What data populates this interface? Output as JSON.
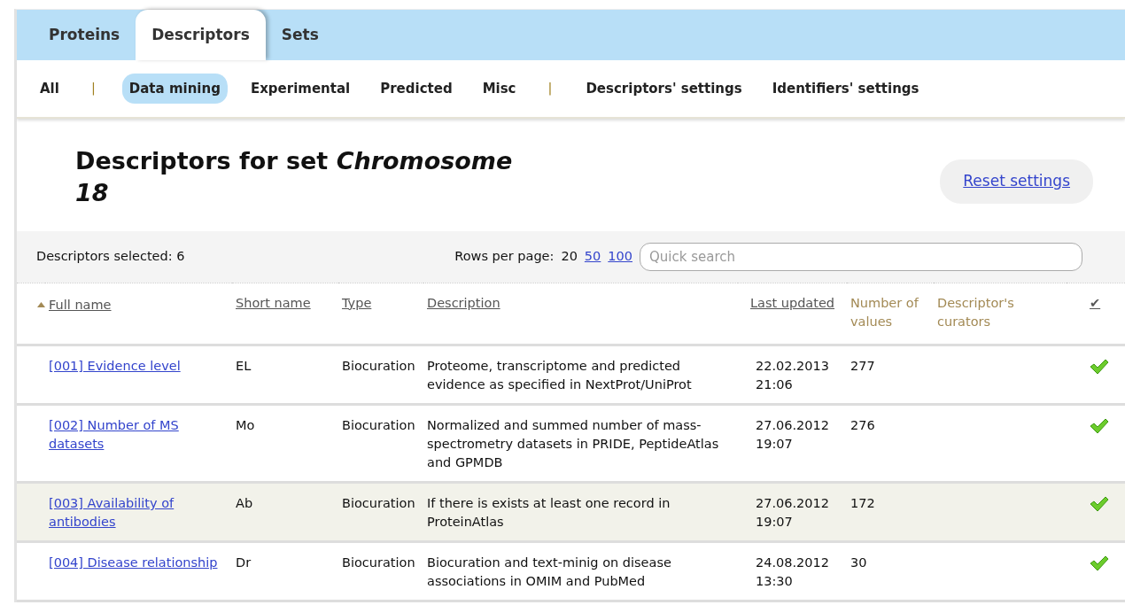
{
  "tabs": [
    {
      "label": "Proteins",
      "selected": false
    },
    {
      "label": "Descriptors",
      "selected": true
    },
    {
      "label": "Sets",
      "selected": false
    }
  ],
  "subnav": [
    {
      "kind": "link",
      "label": "All",
      "selected": false
    },
    {
      "kind": "separator",
      "label": "|"
    },
    {
      "kind": "link",
      "label": "Data mining",
      "selected": true
    },
    {
      "kind": "link",
      "label": "Experimental",
      "selected": false
    },
    {
      "kind": "link",
      "label": "Predicted",
      "selected": false
    },
    {
      "kind": "link",
      "label": "Misc",
      "selected": false
    },
    {
      "kind": "separator",
      "label": "|"
    },
    {
      "kind": "link",
      "label": "Descriptors' settings",
      "selected": false
    },
    {
      "kind": "link",
      "label": "Identifiers' settings",
      "selected": false
    }
  ],
  "heading": "Descriptors for set *Chromosome 18*",
  "reset_button": "Reset settings",
  "toolbar": {
    "selected_count": "Descriptors selected: 6",
    "rows_per_page_label": "Rows per page:",
    "rows_per_page": [
      {
        "label": "20",
        "selected": true
      },
      {
        "label": "50",
        "selected": false
      },
      {
        "label": "100",
        "selected": false
      }
    ],
    "search": {
      "placeholder": "Quick search"
    }
  },
  "table": {
    "columns": [
      {
        "label": "Full name",
        "sortable": true,
        "sorted": true
      },
      {
        "label": "Short name",
        "sortable": true,
        "sorted": false
      },
      {
        "label": "Type",
        "sortable": true,
        "sorted": false
      },
      {
        "label": "Description",
        "sortable": true,
        "sorted": false
      },
      {
        "label": "Last updated",
        "sortable": true,
        "sorted": false
      },
      {
        "label": "Number of values",
        "sortable": false,
        "sorted": false
      },
      {
        "label": "Descriptor's curators",
        "sortable": false,
        "sorted": false
      },
      {
        "label": "✔",
        "sortable": true,
        "sorted": false
      }
    ],
    "rows": [
      {
        "full_name": "[001] Evidence level",
        "short_name": "EL",
        "type": "Biocuration",
        "description": "Proteome, transcriptome and predicted evidence as specified in NextProt/UniProt",
        "last_updated": "22.02.2013 21:06",
        "number_of_values": "277",
        "checked": true,
        "highlighted": false
      },
      {
        "full_name": "[002] Number of MS datasets",
        "short_name": "Mo",
        "type": "Biocuration",
        "description": "Normalized and summed number of mass-spectrometry datasets in PRIDE, PeptideAtlas and GPMDB",
        "last_updated": "27.06.2012 19:07",
        "number_of_values": "276",
        "checked": true,
        "highlighted": false
      },
      {
        "full_name": "[003] Availability of antibodies",
        "short_name": "Ab",
        "type": "Biocuration",
        "description": "If there is exists at least one record in ProteinAtlas",
        "last_updated": "27.06.2012 19:07",
        "number_of_values": "172",
        "checked": true,
        "highlighted": true
      },
      {
        "full_name": "[004] Disease relationship",
        "short_name": "Dr",
        "type": "Biocuration",
        "description": "Biocuration and text-minig on disease associations in OMIM and PubMed",
        "last_updated": "24.08.2012 13:30",
        "number_of_values": "30",
        "checked": true,
        "highlighted": false
      }
    ]
  }
}
